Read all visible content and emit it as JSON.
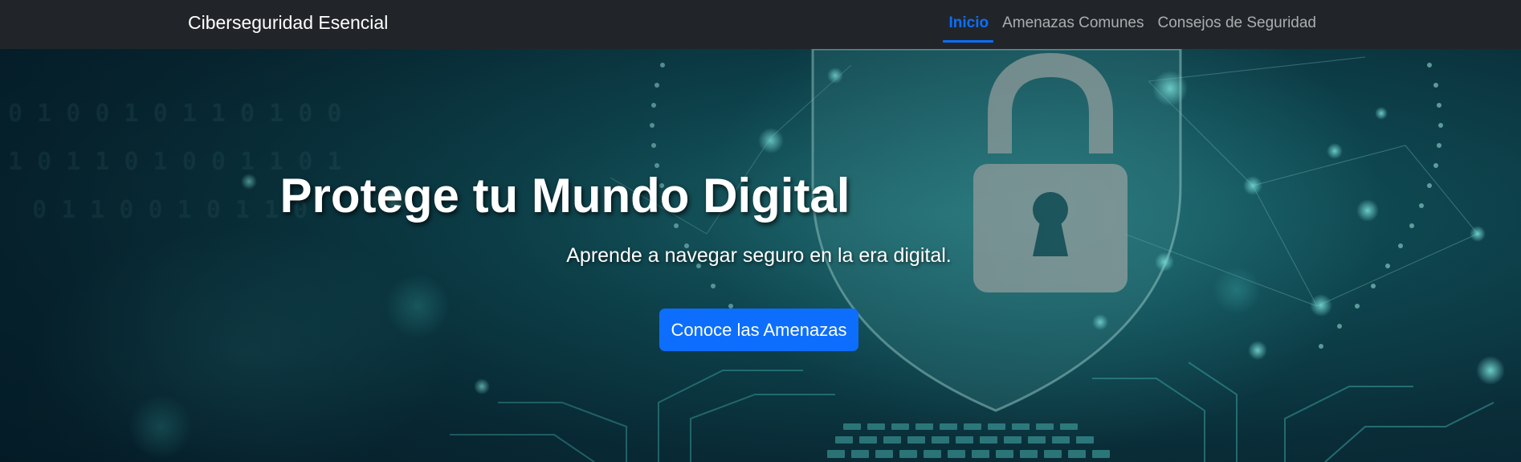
{
  "navbar": {
    "brand": "Ciberseguridad Esencial",
    "links": [
      {
        "label": "Inicio",
        "active": true
      },
      {
        "label": "Amenazas Comunes",
        "active": false
      },
      {
        "label": "Consejos de Seguridad",
        "active": false
      }
    ]
  },
  "hero": {
    "title": "Protege tu Mundo Digital",
    "subtitle": "Aprende a navegar seguro en la era digital.",
    "button_label": "Conoce las Amenazas",
    "background_icon": "padlock-shield-circuit-image"
  },
  "colors": {
    "navbar_bg": "#212529",
    "accent": "#0d6efd",
    "hero_teal": "#0f4a53"
  }
}
